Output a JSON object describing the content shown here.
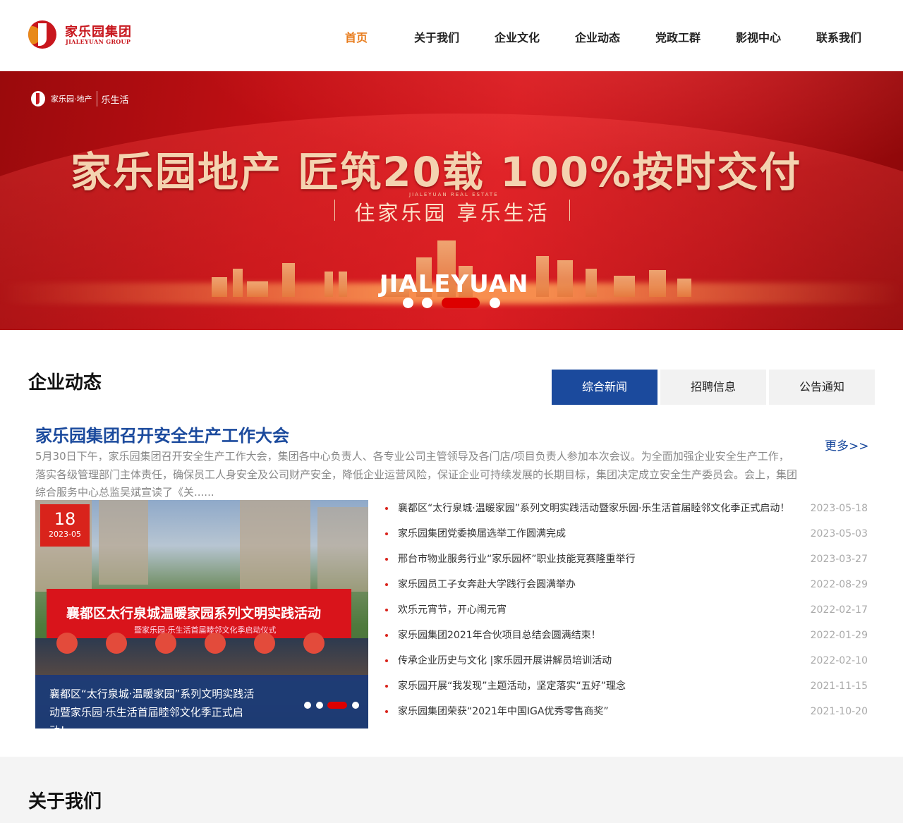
{
  "header": {
    "logo_cn": "家乐园集团",
    "logo_en": "JIALEYUAN GROUP",
    "nav": [
      "首页",
      "关于我们",
      "企业文化",
      "企业动态",
      "党政工群",
      "影视中心",
      "联系我们"
    ],
    "active_index": 0,
    "active_color": "#e87d1e"
  },
  "banner": {
    "logo_text": "家乐园·地产",
    "logo_sub": "Jialeyuan Real Estate",
    "logo_text2": "乐生活",
    "headline": "家乐园地产 匠筑20载 100%按时交付",
    "small": "JIALEYUAN REAL ESTATE",
    "slogan": "住家乐园 享乐生活",
    "brand": "JIALEYUAN",
    "slide_count": 4,
    "active_slide": 2
  },
  "news": {
    "title": "企业动态",
    "tabs": [
      "综合新闻",
      "招聘信息",
      "公告通知"
    ],
    "active_tab": 0,
    "accent": "#1b4a9d",
    "headline": "家乐园集团召开安全生产工作大会",
    "more": "更多>>",
    "summary": "5月30日下午，家乐园集团召开安全生产工作大会，集团各中心负责人、各专业公司主管领导及各门店/项目负责人参加本次会议。为全面加强企业安全生产工作，落实各级管理部门主体责任，确保员工人身安全及公司财产安全，降低企业运营风险，保证企业可持续发展的长期目标，集团决定成立安全生产委员会。会上，集团综合服务中心总监吴斌宣读了《关......",
    "photo": {
      "day": "18",
      "month": "2023-05",
      "banner_text": "襄都区太行泉城温暖家园系列文明实践活动",
      "banner_sub": "暨家乐园·乐生活首届睦邻文化季启动仪式",
      "caption": "襄都区“太行泉城·温暖家园”系列文明实践活动暨家乐园·乐生活首届睦邻文化季正式启动！",
      "slide_count": 4,
      "active_slide": 2
    },
    "items": [
      {
        "title": "襄都区“太行泉城·温暖家园”系列文明实践活动暨家乐园·乐生活首届睦邻文化季正式启动！",
        "date": "2023-05-18"
      },
      {
        "title": "家乐园集团党委换届选举工作圆满完成",
        "date": "2023-05-03"
      },
      {
        "title": "邢台市物业服务行业“家乐园杯”职业技能竞赛隆重举行",
        "date": "2023-03-27"
      },
      {
        "title": "家乐园员工子女奔赴大学践行会圆满举办",
        "date": "2022-08-29"
      },
      {
        "title": "欢乐元宵节，开心闹元宵",
        "date": "2022-02-17"
      },
      {
        "title": "家乐园集团2021年合伙项目总结会圆满结束！",
        "date": "2022-01-29"
      },
      {
        "title": "传承企业历史与文化 |家乐园开展讲解员培训活动",
        "date": "2022-02-10"
      },
      {
        "title": "家乐园开展“我发现”主题活动，坚定落实“五好”理念",
        "date": "2021-11-15"
      },
      {
        "title": "家乐园集团荣获“2021年中国IGA优秀零售商奖”",
        "date": "2021-10-20"
      }
    ]
  },
  "about": {
    "title": "关于我们"
  }
}
